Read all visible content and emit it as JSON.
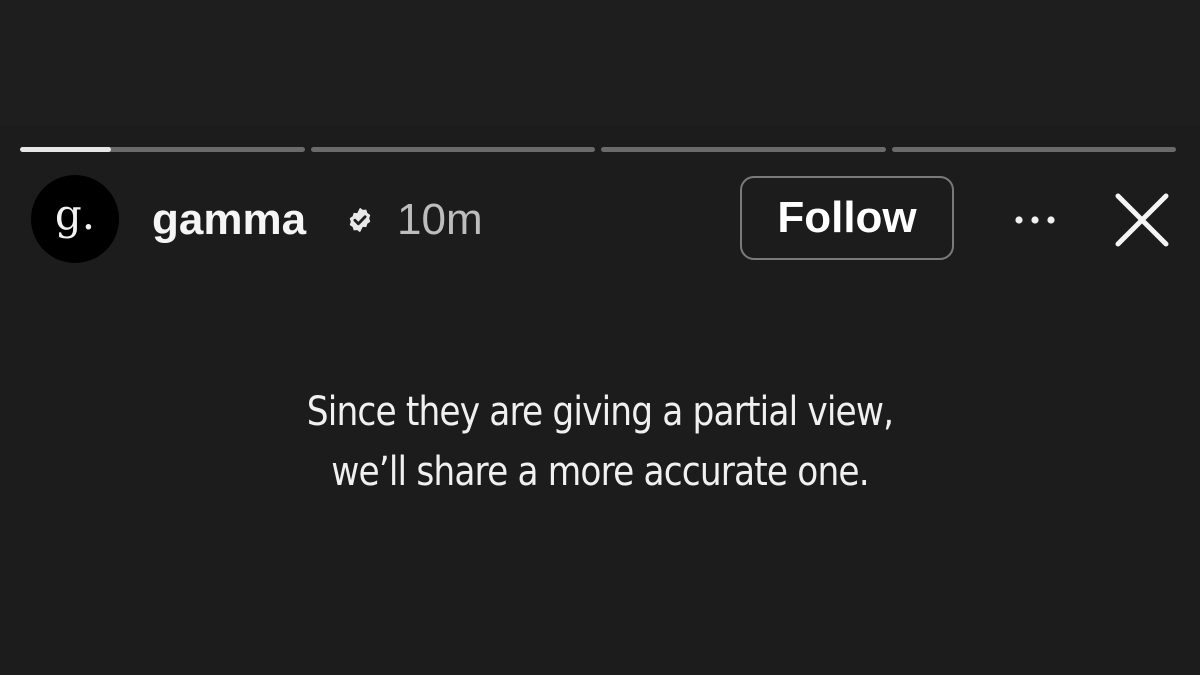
{
  "story": {
    "progress": [
      0.32,
      0,
      0,
      0
    ],
    "account": {
      "avatar_letter": "g.",
      "username": "gamma",
      "verified": true,
      "time": "10m"
    },
    "follow_label": "Follow",
    "icons": {
      "verified": "verified-badge-icon",
      "more": "more-horizontal-icon",
      "close": "close-icon"
    },
    "caption_lines": [
      "Since they are giving a partial view,",
      "we’ll share a more accurate one."
    ]
  },
  "colors": {
    "background": "#1e1e1e",
    "progress_track": "#6a6a6a",
    "progress_fill": "#e6e6e6",
    "text": "#f5f5f5",
    "muted_text": "#bdbdbd",
    "button_border": "#7a7a7a"
  }
}
